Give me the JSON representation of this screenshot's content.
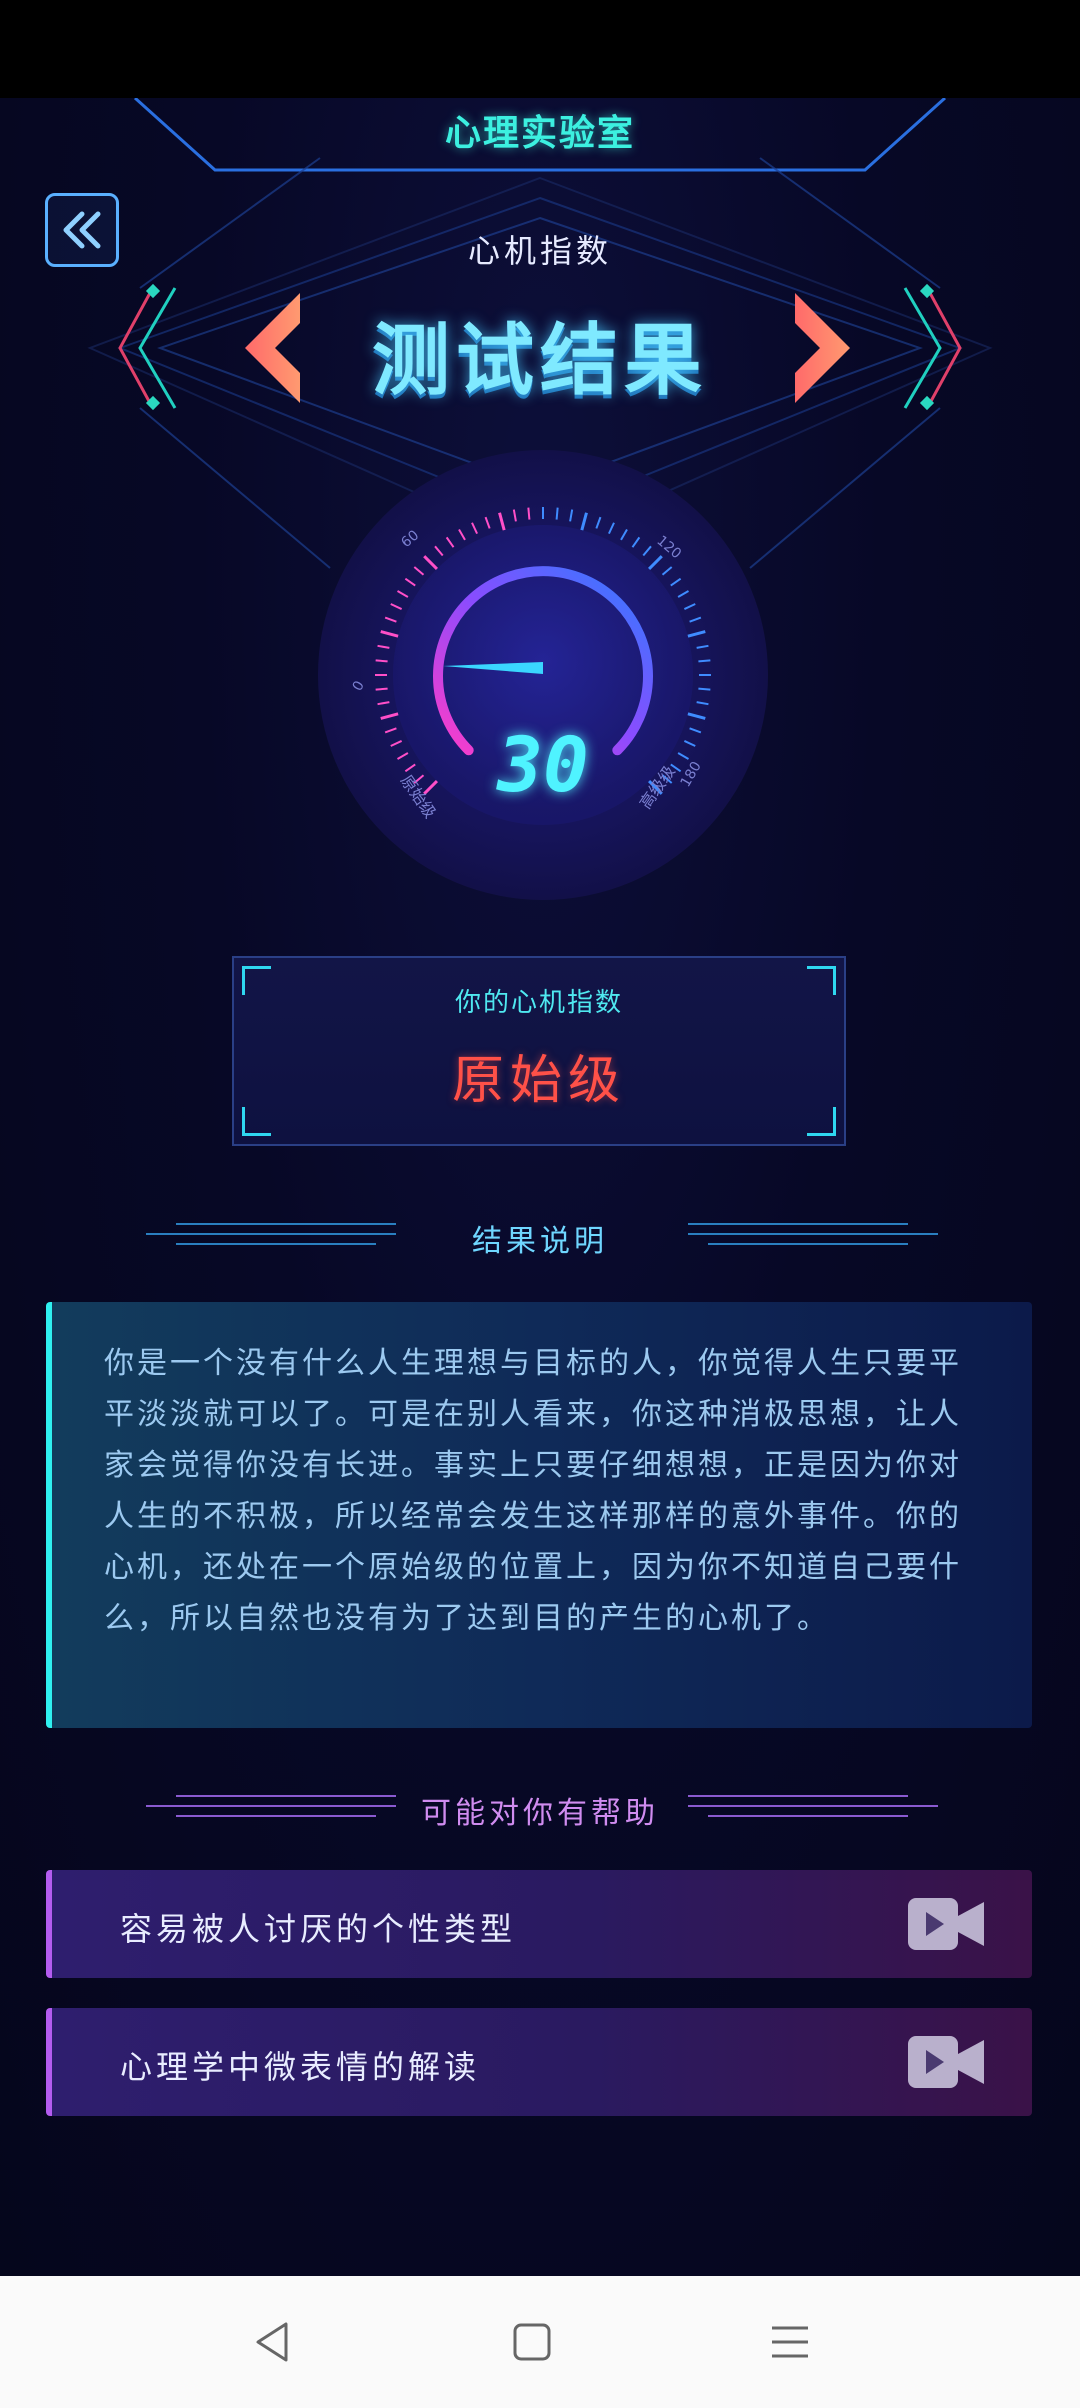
{
  "header": {
    "app_title": "心理实验室",
    "subtitle": "心机指数",
    "result_title": "测试结果"
  },
  "gauge": {
    "value": "30",
    "value_number": 30,
    "min": 0,
    "max": 180,
    "tick_labels": [
      "0",
      "60",
      "120",
      "180"
    ],
    "left_label": "原始级",
    "right_label": "高级级"
  },
  "level": {
    "label": "你的心机指数",
    "value": "原始级"
  },
  "explanation": {
    "title": "结果说明",
    "text": "你是一个没有什么人生理想与目标的人，你觉得人生只要平平淡淡就可以了。可是在别人看来，你这种消极思想，让人家会觉得你没有长进。事实上只要仔细想想，正是因为你对人生的不积极，所以经常会发生这样那样的意外事件。你的心机，还处在一个原始级的位置上，因为你不知道自己要什么，所以自然也没有为了达到目的产生的心机了。"
  },
  "help": {
    "title": "可能对你有帮助",
    "items": [
      {
        "label": "容易被人讨厌的个性类型",
        "icon": "video-icon"
      },
      {
        "label": "心理学中微表情的解读",
        "icon": "video-icon"
      }
    ]
  },
  "colors": {
    "accent_cyan": "#3cf0e0",
    "level_red": "#ff5148",
    "help_purple": "#b45cf0"
  }
}
